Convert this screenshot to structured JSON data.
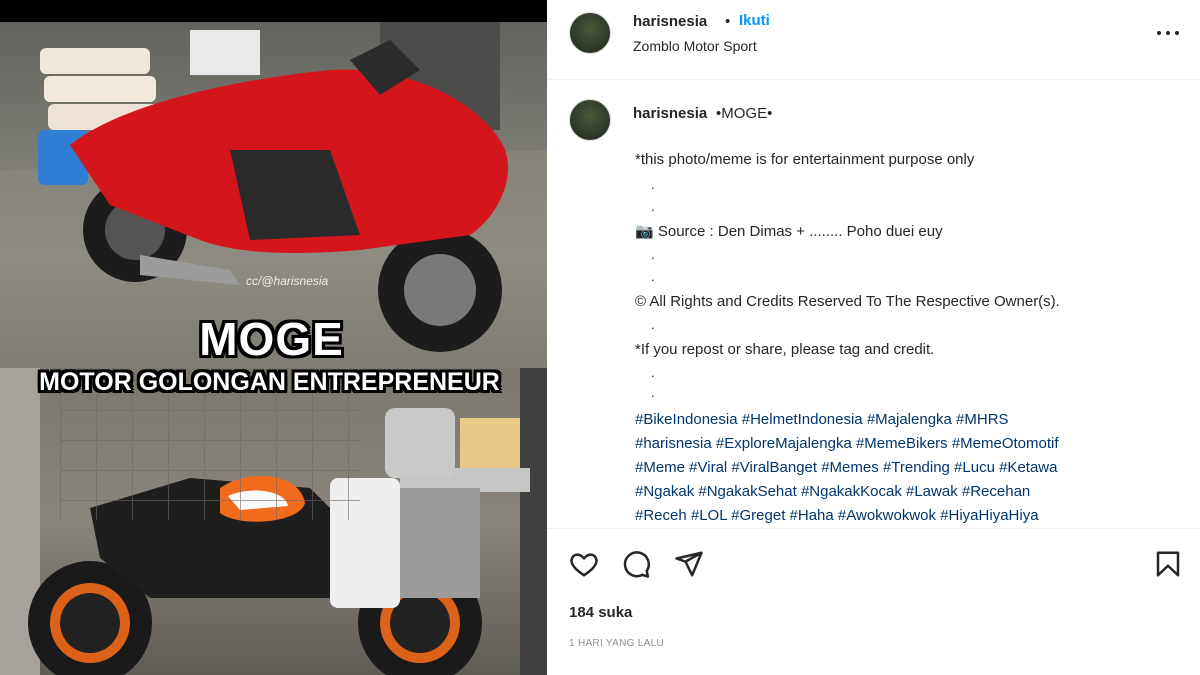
{
  "media": {
    "meme_title": "MOGE",
    "meme_subtitle": "MOTOR GOLONGAN ENTREPRENEUR",
    "watermark": "cc/@harisnesia",
    "bike_top_color": "#d4161c",
    "bike_bottom_accent": "#f26a1b"
  },
  "header": {
    "username": "harisnesia",
    "separator": "•",
    "follow_label": "Ikuti",
    "location": "Zomblo Motor Sport",
    "more_icon": "more-horizontal-icon"
  },
  "caption": {
    "username": "harisnesia",
    "title": "•MOGE•",
    "lines": [
      "*this photo/meme is for entertainment purpose only",
      "📷 Source : Den Dimas + ........ Poho duei euy",
      "© All Rights and Credits Reserved To The Respective Owner(s).",
      "*If you repost or share, please tag and credit."
    ],
    "dot": ".",
    "hashtag_lines": [
      "#BikeIndonesia #HelmetIndonesia #Majalengka #MHRS",
      "#harisnesia #ExploreMajalengka #MemeBikers #MemeOtomotif",
      "#Meme #Viral #ViralBanget #Memes #Trending #Lucu #Ketawa",
      "#Ngakak #NgakakSehat #NgakakKocak #Lawak #Recehan",
      "#Receh #LOL #Greget #Haha #Awokwokwok #HiyaHiyaHiya"
    ]
  },
  "actions": {
    "like_icon": "heart-icon",
    "comment_icon": "comment-icon",
    "share_icon": "send-icon",
    "save_icon": "bookmark-icon",
    "likes_text": "184 suka",
    "time_ago": "1 HARI YANG LALU"
  },
  "colors": {
    "link_blue": "#0095f6",
    "hashtag": "#00376b",
    "text": "#262626",
    "muted": "#8e8e8e"
  }
}
